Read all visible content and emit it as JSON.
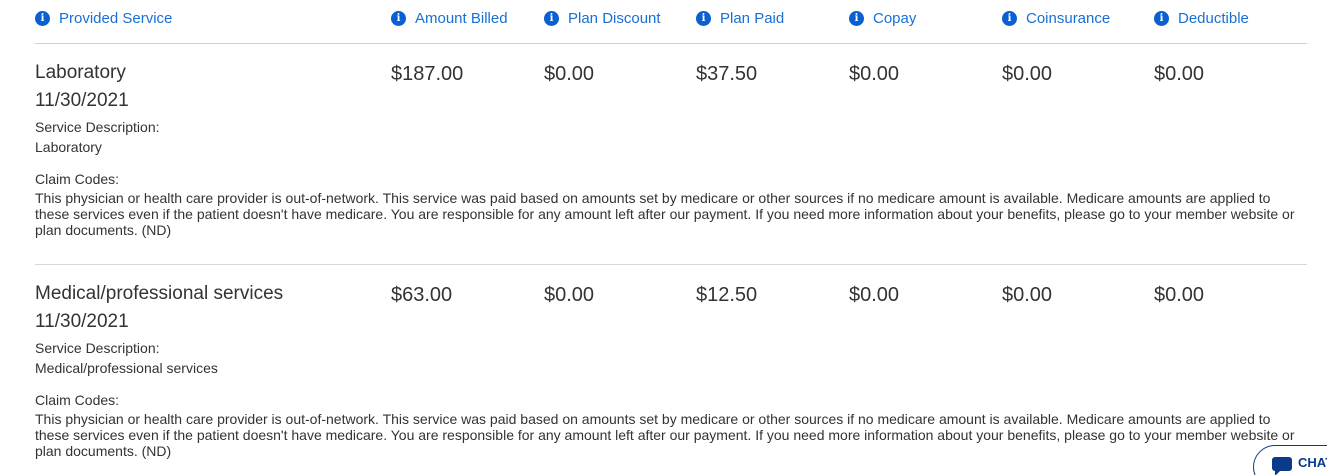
{
  "header": {
    "columns": [
      {
        "label": "Provided Service"
      },
      {
        "label": "Amount Billed"
      },
      {
        "label": "Plan Discount"
      },
      {
        "label": "Plan Paid"
      },
      {
        "label": "Copay"
      },
      {
        "label": "Coinsurance"
      },
      {
        "label": "Deductible"
      }
    ]
  },
  "services": [
    {
      "name": "Laboratory",
      "date": "11/30/2021",
      "amount_billed": "$187.00",
      "plan_discount": "$0.00",
      "plan_paid": "$37.50",
      "copay": "$0.00",
      "coinsurance": "$0.00",
      "deductible": "$0.00",
      "description_label": "Service Description:",
      "description": "Laboratory",
      "claim_codes_label": "Claim Codes:",
      "claim_codes": "This physician or health care provider is out-of-network. This service was paid based on amounts set by medicare or other sources if no medicare amount is available. Medicare amounts are applied to these services even if the patient doesn't have medicare. You are responsible for any amount left after our payment. If you need more information about your benefits, please go to your member website or plan documents. (ND)"
    },
    {
      "name": "Medical/professional services",
      "date": "11/30/2021",
      "amount_billed": "$63.00",
      "plan_discount": "$0.00",
      "plan_paid": "$12.50",
      "copay": "$0.00",
      "coinsurance": "$0.00",
      "deductible": "$0.00",
      "description_label": "Service Description:",
      "description": "Medical/professional services",
      "claim_codes_label": "Claim Codes:",
      "claim_codes": "This physician or health care provider is out-of-network. This service was paid based on amounts set by medicare or other sources if no medicare amount is available. Medicare amounts are applied to these services even if the patient doesn't have medicare. You are responsible for any amount left after our payment. If you need more information about your benefits, please go to your member website or plan documents. (ND)"
    }
  ],
  "chat": {
    "label": "CHAT"
  },
  "colors": {
    "link_blue": "#1a6fd6",
    "icon_blue": "#0a5fd1",
    "chat_navy": "#0a3a8a"
  }
}
